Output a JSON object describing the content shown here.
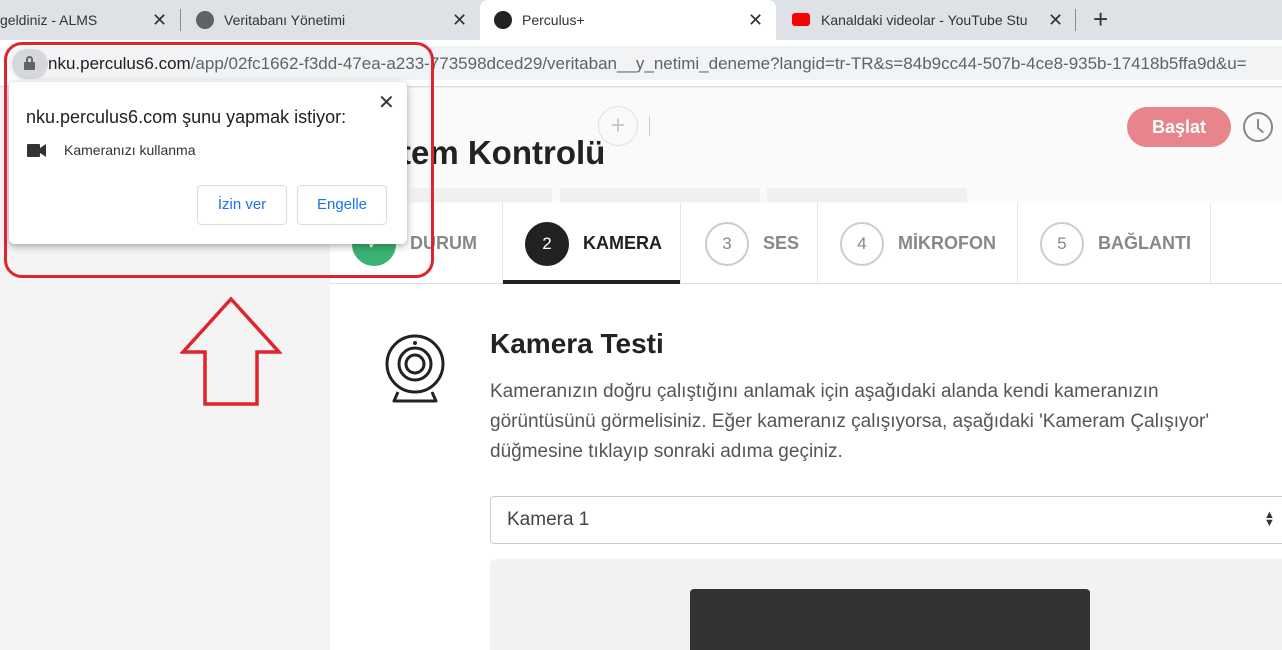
{
  "browser": {
    "tabs": [
      {
        "title": "geldiniz - ALMS",
        "active": false
      },
      {
        "title": "Veritabanı Yönetimi",
        "active": false
      },
      {
        "title": "Perculus+",
        "active": true
      },
      {
        "title": "Kanaldaki videolar - YouTube Stu",
        "active": false
      }
    ],
    "url_host": "nku.perculus6.com",
    "url_path": "/app/02fc1662-f3dd-47ea-a233-773598dced29/veritaban__y_netimi_deneme?langid=tr-TR&s=84b9cc44-507b-4ce8-935b-17418b5ffa9d&u="
  },
  "permission_popup": {
    "title": "nku.perculus6.com şunu yapmak istiyor:",
    "permission": "Kameranızı kullanma",
    "allow_label": "İzin ver",
    "block_label": "Engelle"
  },
  "header": {
    "title": "tem Kontrolü",
    "start_label": "Başlat",
    "add_symbol": "+"
  },
  "steps": [
    {
      "num": "✓",
      "label": "DURUM",
      "state": "done"
    },
    {
      "num": "2",
      "label": "KAMERA",
      "state": "active"
    },
    {
      "num": "3",
      "label": "SES",
      "state": "pending"
    },
    {
      "num": "4",
      "label": "MİKROFON",
      "state": "pending"
    },
    {
      "num": "5",
      "label": "BAĞLANTI",
      "state": "pending"
    }
  ],
  "camera_test": {
    "heading": "Kamera Testi",
    "description": "Kameranızın doğru çalıştığını anlamak için aşağıdaki alanda kendi kameranızın görüntüsünü görmelisiniz. Eğer kameranız çalışıyorsa, aşağıdaki 'Kameram Çalışıyor' düğmesine tıklayıp sonraki adıma geçiniz.",
    "selected_camera": "Kamera 1"
  },
  "colors": {
    "accent": "#e8848c",
    "annotation": "#e0242e",
    "done": "#3bb273",
    "active_step": "#222222"
  }
}
